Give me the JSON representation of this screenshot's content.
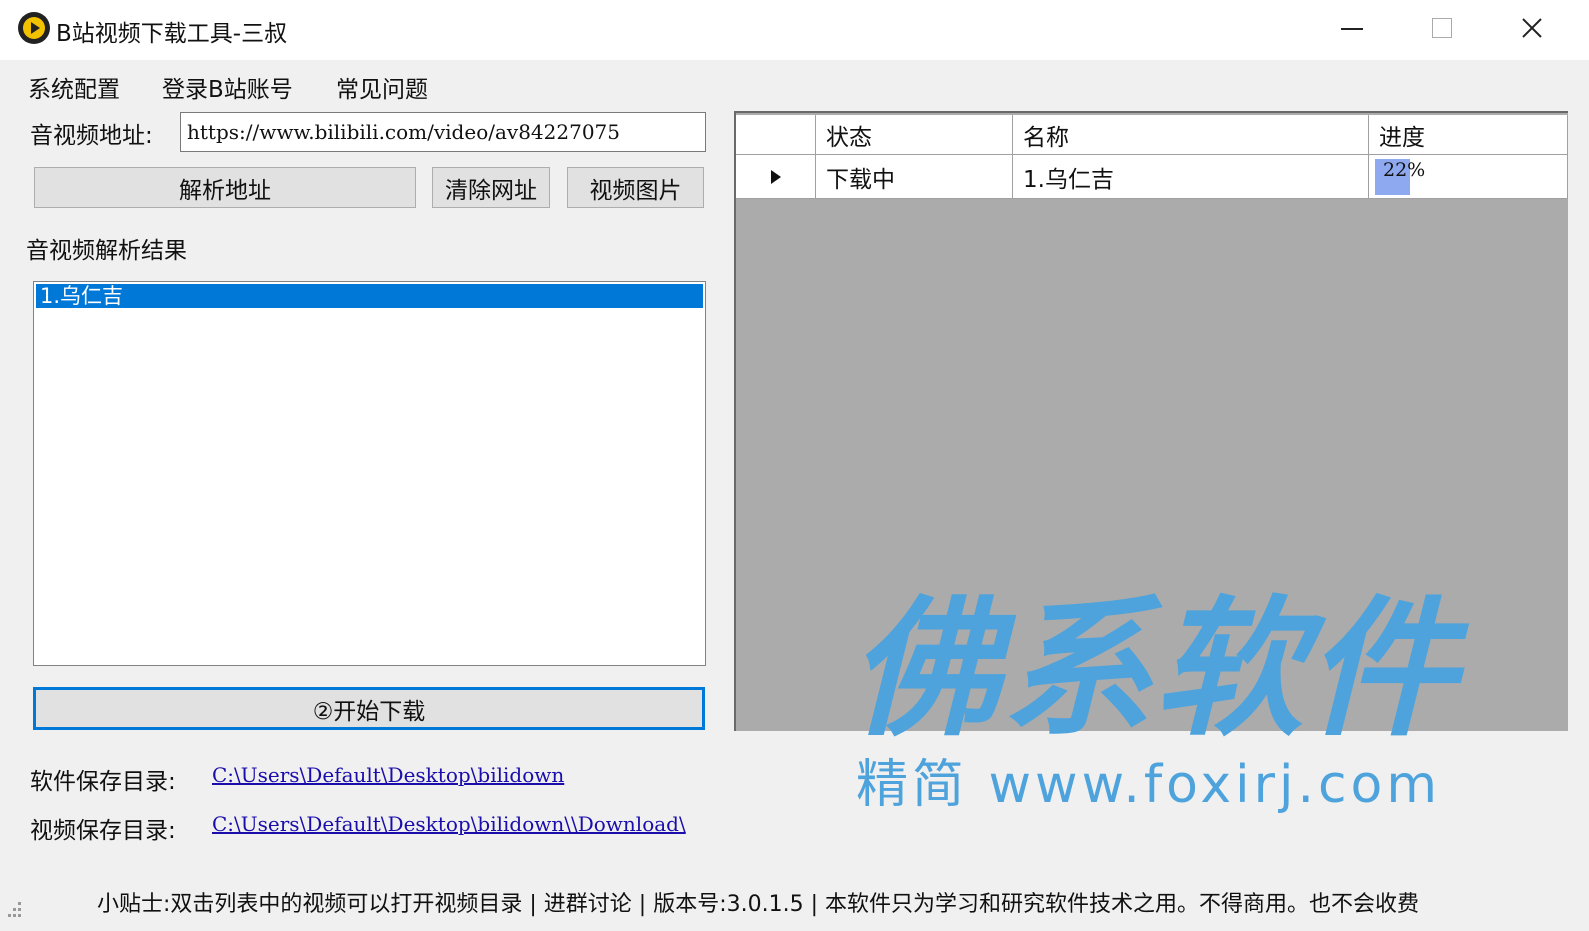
{
  "window": {
    "title": "B站视频下载工具-三叔"
  },
  "menu": {
    "items": [
      "系统配置",
      "登录B站账号",
      "常见问题"
    ]
  },
  "form": {
    "url_label": "音视频地址:",
    "url_value": "https://www.bilibili.com/video/av84227075",
    "parse_button": "解析地址",
    "clear_button": "清除网址",
    "image_button": "视频图片",
    "results_label": "音视频解析结果",
    "results": [
      "1.乌仁吉"
    ],
    "start_button": "②开始下载",
    "software_dir_label": "软件保存目录:",
    "software_dir": "C:\\Users\\Default\\Desktop\\bilidown",
    "video_dir_label": "视频保存目录:",
    "video_dir": "C:\\Users\\Default\\Desktop\\bilidown\\\\Download\\"
  },
  "grid": {
    "columns": [
      "状态",
      "名称",
      "进度"
    ],
    "rows": [
      {
        "status": "下载中",
        "name": "1.乌仁吉",
        "progress_text": "22%",
        "progress": 0.22
      }
    ]
  },
  "watermark": {
    "main": "佛系软件",
    "sub": "精简 www.foxirj.com"
  },
  "status_bar": {
    "text": "小贴士:双击列表中的视频可以打开视频目录 | 进群讨论 | 版本号:3.0.1.5 | 本软件只为学习和研究软件技术之用。不得商用。也不会收费"
  },
  "colors": {
    "selection": "#0078d7",
    "progress_fill": "#8ea9f0",
    "watermark": "#4ea3dd",
    "link": "#1a0dab"
  }
}
